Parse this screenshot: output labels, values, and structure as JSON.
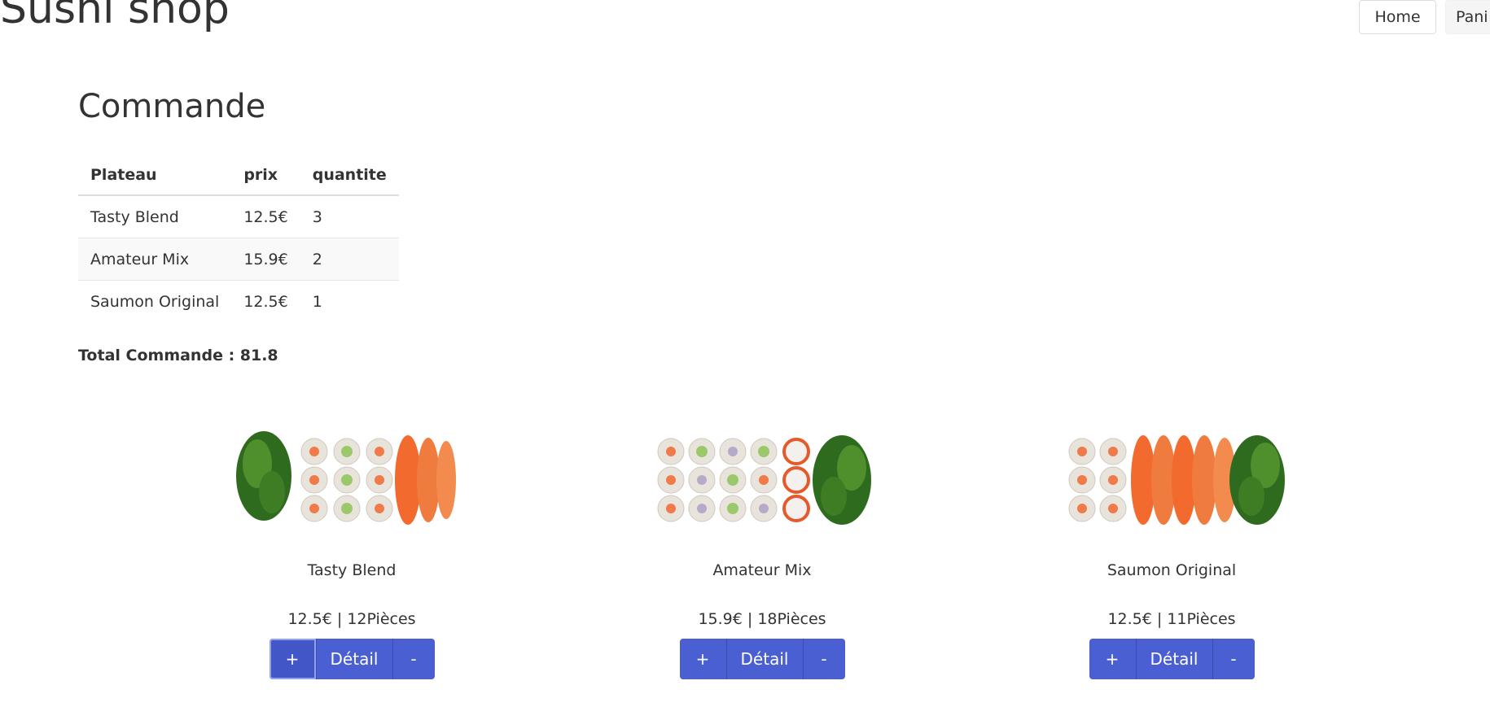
{
  "header": {
    "site_title": "Sushi shop",
    "nav": {
      "home": "Home",
      "panier": "Pani"
    }
  },
  "order": {
    "title": "Commande",
    "columns": [
      "Plateau",
      "prix",
      "quantite"
    ],
    "rows": [
      [
        "Tasty Blend",
        "12.5€",
        "3"
      ],
      [
        "Amateur Mix",
        "15.9€",
        "2"
      ],
      [
        "Saumon Original",
        "12.5€",
        "1"
      ]
    ],
    "total": "Total Commande : 81.8"
  },
  "products": [
    {
      "name": "Tasty Blend",
      "info": "12.5€ | 12Pièces",
      "plus": "+",
      "detail": "Détail",
      "minus": "-"
    },
    {
      "name": "Amateur Mix",
      "info": "15.9€ | 18Pièces",
      "plus": "+",
      "detail": "Détail",
      "minus": "-"
    },
    {
      "name": "Saumon Original",
      "info": "12.5€ | 11Pièces",
      "plus": "+",
      "detail": "Détail",
      "minus": "-"
    }
  ],
  "colors": {
    "button": "#4a5fd1",
    "text": "#333333"
  }
}
